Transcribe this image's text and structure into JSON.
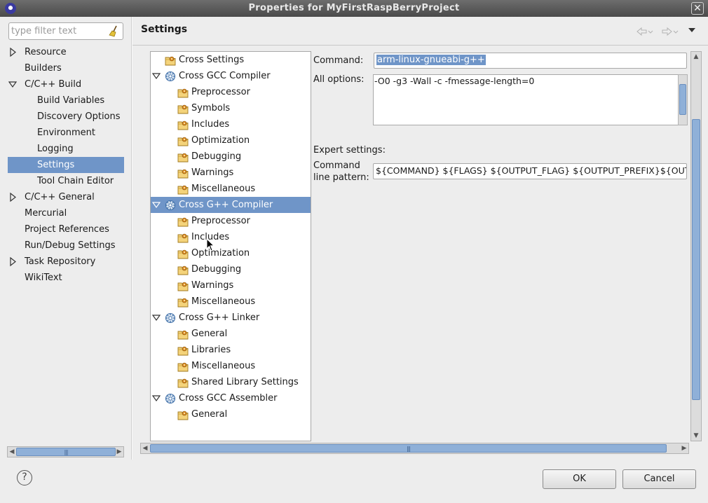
{
  "window": {
    "title": "Properties for MyFirstRaspBerryProject"
  },
  "filter": {
    "placeholder": "type filter text"
  },
  "nav": {
    "items": [
      {
        "label": "Resource",
        "level": 0,
        "expander": "collapsed"
      },
      {
        "label": "Builders",
        "level": 0,
        "expander": "none"
      },
      {
        "label": "C/C++ Build",
        "level": 0,
        "expander": "expanded"
      },
      {
        "label": "Build Variables",
        "level": 1,
        "expander": "none"
      },
      {
        "label": "Discovery Options",
        "level": 1,
        "expander": "none"
      },
      {
        "label": "Environment",
        "level": 1,
        "expander": "none"
      },
      {
        "label": "Logging",
        "level": 1,
        "expander": "none"
      },
      {
        "label": "Settings",
        "level": 1,
        "expander": "none",
        "selected": true
      },
      {
        "label": "Tool Chain Editor",
        "level": 1,
        "expander": "none"
      },
      {
        "label": "C/C++ General",
        "level": 0,
        "expander": "collapsed"
      },
      {
        "label": "Mercurial",
        "level": 0,
        "expander": "none"
      },
      {
        "label": "Project References",
        "level": 0,
        "expander": "none"
      },
      {
        "label": "Run/Debug Settings",
        "level": 0,
        "expander": "none"
      },
      {
        "label": "Task Repository",
        "level": 0,
        "expander": "collapsed"
      },
      {
        "label": "WikiText",
        "level": 0,
        "expander": "none"
      }
    ]
  },
  "page": {
    "title": "Settings"
  },
  "tool_tree": {
    "items": [
      {
        "label": "Cross Settings",
        "level": 0,
        "icon": "folder-settings-icon",
        "expander": "none"
      },
      {
        "label": "Cross GCC Compiler",
        "level": 0,
        "icon": "tool-gear-icon",
        "expander": "expanded"
      },
      {
        "label": "Preprocessor",
        "level": 1,
        "icon": "folder-settings-icon"
      },
      {
        "label": "Symbols",
        "level": 1,
        "icon": "folder-settings-icon"
      },
      {
        "label": "Includes",
        "level": 1,
        "icon": "folder-settings-icon"
      },
      {
        "label": "Optimization",
        "level": 1,
        "icon": "folder-settings-icon"
      },
      {
        "label": "Debugging",
        "level": 1,
        "icon": "folder-settings-icon"
      },
      {
        "label": "Warnings",
        "level": 1,
        "icon": "folder-settings-icon"
      },
      {
        "label": "Miscellaneous",
        "level": 1,
        "icon": "folder-settings-icon"
      },
      {
        "label": "Cross G++ Compiler",
        "level": 0,
        "icon": "tool-gear-icon",
        "expander": "expanded",
        "selected": true
      },
      {
        "label": "Preprocessor",
        "level": 1,
        "icon": "folder-settings-icon"
      },
      {
        "label": "Includes",
        "level": 1,
        "icon": "folder-settings-icon"
      },
      {
        "label": "Optimization",
        "level": 1,
        "icon": "folder-settings-icon"
      },
      {
        "label": "Debugging",
        "level": 1,
        "icon": "folder-settings-icon"
      },
      {
        "label": "Warnings",
        "level": 1,
        "icon": "folder-settings-icon"
      },
      {
        "label": "Miscellaneous",
        "level": 1,
        "icon": "folder-settings-icon"
      },
      {
        "label": "Cross G++ Linker",
        "level": 0,
        "icon": "tool-gear-icon",
        "expander": "expanded"
      },
      {
        "label": "General",
        "level": 1,
        "icon": "folder-settings-icon"
      },
      {
        "label": "Libraries",
        "level": 1,
        "icon": "folder-settings-icon"
      },
      {
        "label": "Miscellaneous",
        "level": 1,
        "icon": "folder-settings-icon"
      },
      {
        "label": "Shared Library Settings",
        "level": 1,
        "icon": "folder-settings-icon"
      },
      {
        "label": "Cross GCC Assembler",
        "level": 0,
        "icon": "tool-gear-icon",
        "expander": "expanded"
      },
      {
        "label": "General",
        "level": 1,
        "icon": "folder-settings-icon"
      }
    ]
  },
  "options": {
    "command_label": "Command:",
    "command_value": "arm-linux-gnueabi-g++",
    "all_options_label": "All options:",
    "all_options_value": "-O0 -g3 -Wall -c -fmessage-length=0",
    "expert_label": "Expert settings:",
    "pattern_label_line1": "Command",
    "pattern_label_line2": "line pattern:",
    "pattern_value": "${COMMAND} ${FLAGS} ${OUTPUT_FLAG} ${OUTPUT_PREFIX}${OUTPUT} ${INPUTS}"
  },
  "buttons": {
    "ok": "OK",
    "cancel": "Cancel",
    "help": "?"
  },
  "colors": {
    "selection": "#6f95c8",
    "titlebar": "#5a5a5a",
    "scroll_thumb": "#8fb0d8"
  }
}
